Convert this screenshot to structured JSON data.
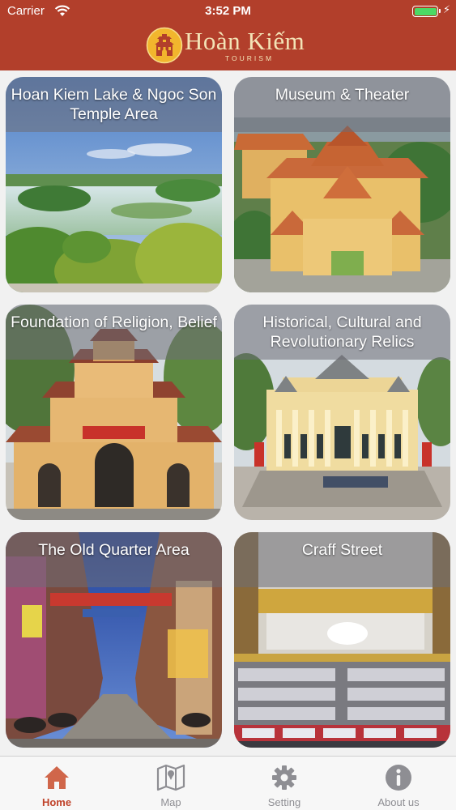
{
  "status_bar": {
    "carrier": "Carrier",
    "time": "3:52 PM",
    "battery_level": 1.0,
    "icons": [
      "wifi-icon",
      "battery-icon",
      "charging-bolt-icon"
    ]
  },
  "header": {
    "brand_name": "Hoàn Kiếm",
    "brand_subtitle": "TOURISM",
    "logo_icon": "temple-logo-icon",
    "background_color": "#b23f2b"
  },
  "categories": [
    {
      "title": "Hoan Kiem Lake & Ngoc Son Temple Area"
    },
    {
      "title": "Museum & Theater"
    },
    {
      "title": "Foundation of Religion, Belief"
    },
    {
      "title": "Historical, Cultural and Revolutionary Relics"
    },
    {
      "title": "The Old Quarter Area"
    },
    {
      "title": "Craff Street"
    }
  ],
  "tab_bar": {
    "active_tab": "Home",
    "accent_color": "#c0432b",
    "tabs": [
      {
        "label": "Home",
        "icon": "home-icon"
      },
      {
        "label": "Map",
        "icon": "map-icon"
      },
      {
        "label": "Setting",
        "icon": "gear-icon"
      },
      {
        "label": "About us",
        "icon": "info-icon"
      }
    ]
  }
}
